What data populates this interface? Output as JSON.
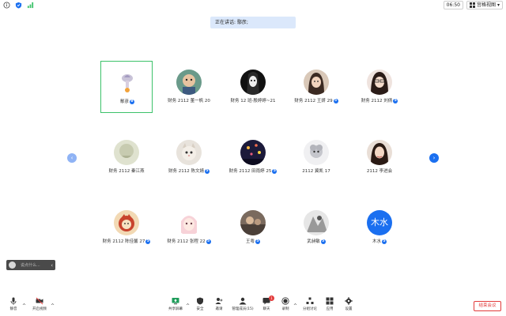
{
  "topbar": {
    "timer": "06:50",
    "view_label": "宫格视图",
    "view_caret": "▾"
  },
  "speaking": {
    "text": "正在讲话: 鄢彦;"
  },
  "participants": [
    {
      "name": "鄢彦",
      "badge": "8"
    },
    {
      "name": "财务 2112 董一帆 20",
      "badge": ""
    },
    {
      "name": "财务 12 班-殷婷婷~21",
      "badge": ""
    },
    {
      "name": "财务 2112 王妍 29",
      "badge": "5"
    },
    {
      "name": "财务 2112 刘倩",
      "badge": "5"
    },
    {
      "name": "财务 2112 秦江燕",
      "badge": ""
    },
    {
      "name": "财务 2112 陈文婧",
      "badge": "5"
    },
    {
      "name": "财务 2112 田雨婷 25",
      "badge": "5"
    },
    {
      "name": "2112 冀凯 17",
      "badge": ""
    },
    {
      "name": "2112 李进会",
      "badge": ""
    },
    {
      "name": "财务 2112 陈佳馨 27",
      "badge": "5"
    },
    {
      "name": "财务 2112 张程 22",
      "badge": "5"
    },
    {
      "name": "王粤",
      "badge": "5"
    },
    {
      "name": "武昶敏",
      "badge": "5"
    },
    {
      "name": "木水",
      "badge": "5"
    }
  ],
  "avatar_texts": {
    "mushui": "木水"
  },
  "nav": {
    "prev": "‹",
    "next": "›"
  },
  "chat": {
    "placeholder": "说点什么...",
    "collapse": "‹"
  },
  "toolbar": {
    "mute": "静音",
    "video": "开启视频",
    "share": "共享屏幕",
    "security": "安全",
    "invite": "邀请",
    "participants": "管理成员(15)",
    "chat": "聊天",
    "chat_badge": "1",
    "record": "录制",
    "breakout": "分组讨论",
    "apps": "应用",
    "settings": "设置",
    "end": "结束会议",
    "caret": "^"
  },
  "colors": {
    "accent": "#1a6ff0",
    "active_border": "#3cc26a",
    "end": "#e23b3b"
  }
}
